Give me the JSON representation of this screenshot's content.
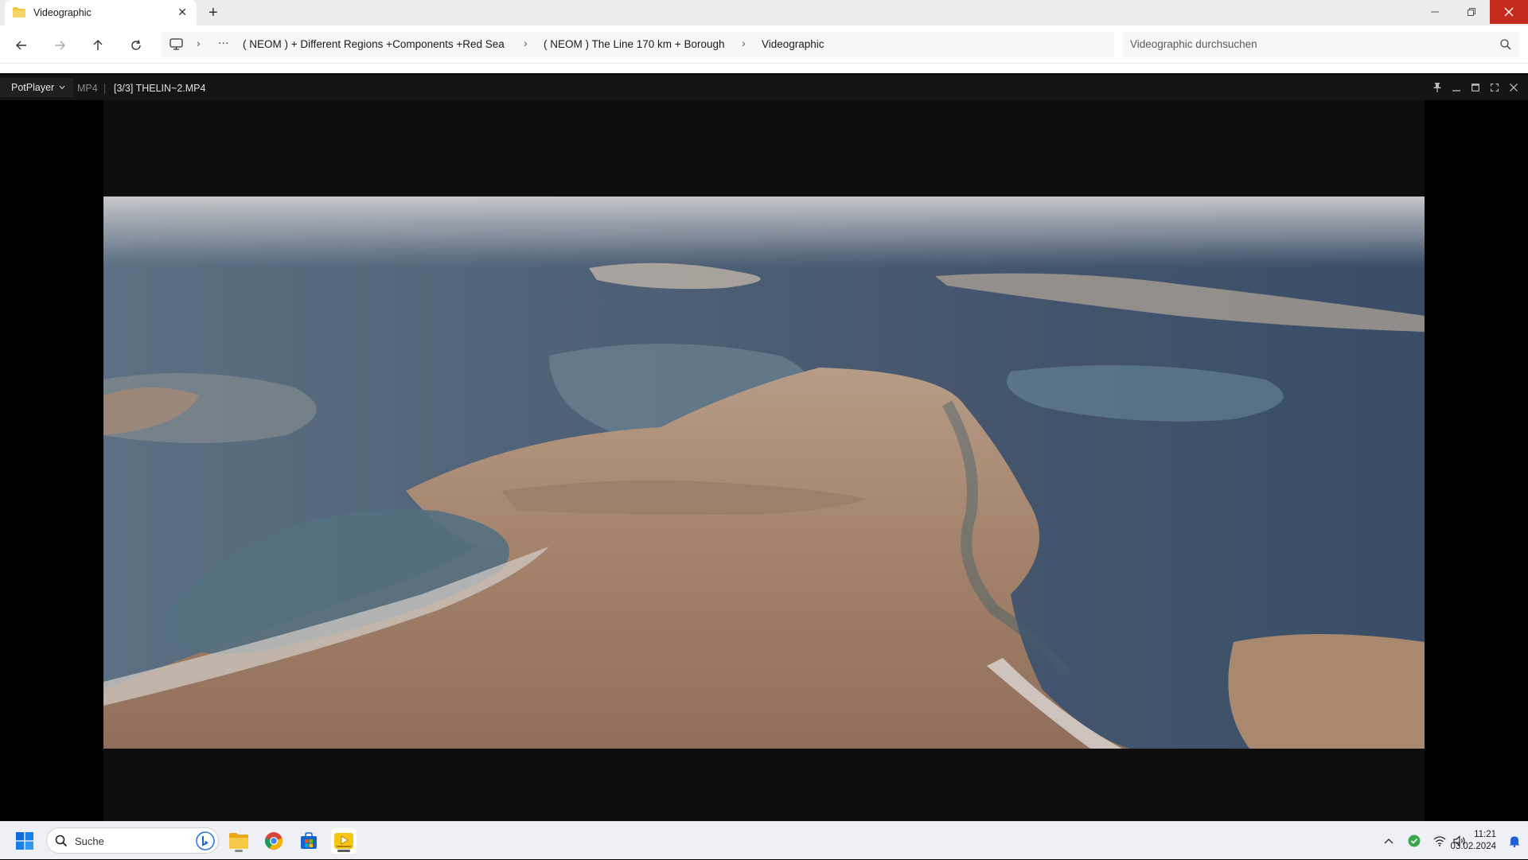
{
  "explorer": {
    "tab_title": "Videographic",
    "nav": {
      "back": "back-arrow",
      "forward": "forward-arrow",
      "up": "up-arrow",
      "refresh": "refresh"
    },
    "breadcrumbs": [
      "( NEOM ) + Different Regions +Components +Red Sea",
      "( NEOM ) The Line 170 km + Borough",
      "Videographic"
    ],
    "overflow_label": "···",
    "search_placeholder": "Videographic durchsuchen"
  },
  "player": {
    "brand": "PotPlayer",
    "format": "MP4",
    "file": "[3/3] THELIN~2.MP4"
  },
  "taskbar": {
    "search_placeholder": "Suche",
    "apps": [
      "file-explorer",
      "chrome",
      "microsoft-store",
      "potplayer"
    ],
    "time": "11:21",
    "date": "03.02.2024"
  },
  "colors": {
    "close_red": "#c42b1c",
    "player_bar": "#151515",
    "folder_yellow": "#f4c542"
  }
}
